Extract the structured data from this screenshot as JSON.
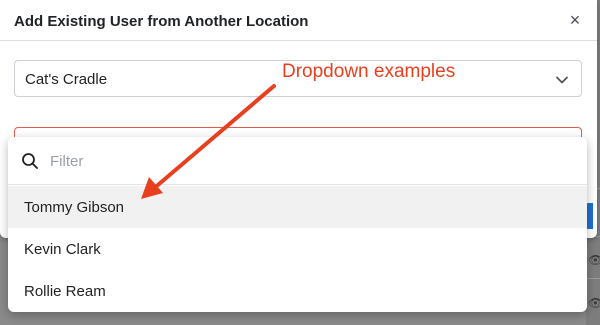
{
  "modal": {
    "title": "Add Existing User from Another Location",
    "close_symbol": "×",
    "location_select": {
      "value": "Cat's Cradle"
    }
  },
  "dropdown": {
    "filter_placeholder": "Filter",
    "options": [
      {
        "label": "Tommy Gibson",
        "highlighted": true
      },
      {
        "label": "Kevin Clark",
        "highlighted": false
      },
      {
        "label": "Rollie Ream",
        "highlighted": false
      }
    ]
  },
  "annotation": {
    "text": "Dropdown examples",
    "color": "#e8401f"
  },
  "colors": {
    "accent": "#1f6fd1",
    "error_border": "#e05b52",
    "highlight_row": "#f1f1f1"
  },
  "icons": {
    "close": "close-icon",
    "chevron": "chevron-down-icon",
    "search": "search-icon"
  }
}
